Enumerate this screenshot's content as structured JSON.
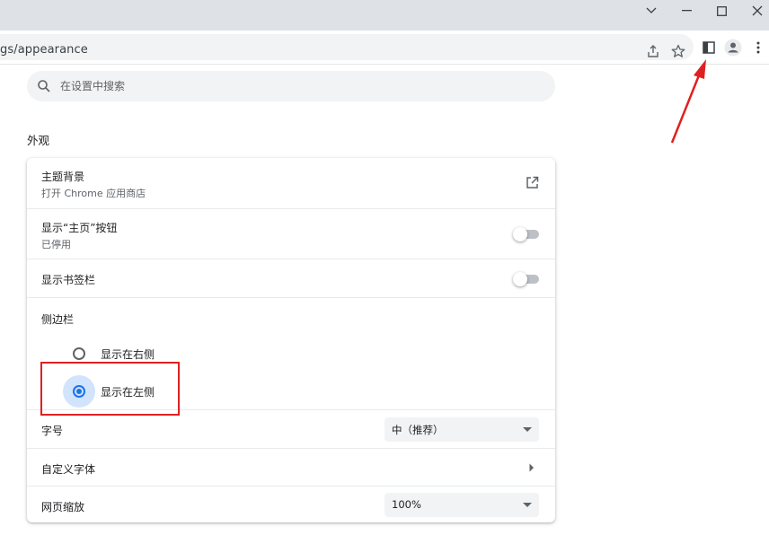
{
  "browser": {
    "url": "gs/appearance",
    "window_buttons": [
      "chevron-down",
      "minimize",
      "maximize",
      "close"
    ],
    "toolbar_icons": [
      "share-icon",
      "star-icon",
      "side-panel-icon",
      "profile-icon",
      "more-icon"
    ]
  },
  "search": {
    "placeholder": "在设置中搜索"
  },
  "section": {
    "title": "外观"
  },
  "settings": {
    "theme": {
      "label": "主题背景",
      "sub": "打开 Chrome 应用商店"
    },
    "home_button": {
      "label": "显示“主页”按钮",
      "sub": "已停用",
      "enabled": false
    },
    "bookmarks_bar": {
      "label": "显示书签栏",
      "enabled": false
    },
    "side_panel": {
      "label": "侧边栏",
      "options": [
        {
          "label": "显示在右侧",
          "checked": false
        },
        {
          "label": "显示在左侧",
          "checked": true
        }
      ]
    },
    "font_size": {
      "label": "字号",
      "value": "中（推荐）"
    },
    "custom_fonts": {
      "label": "自定义字体"
    },
    "page_zoom": {
      "label": "网页缩放",
      "value": "100%"
    }
  },
  "colors": {
    "accent": "#1a73e8",
    "highlight_box": "#e02020",
    "annotation_arrow": "#e02020"
  }
}
